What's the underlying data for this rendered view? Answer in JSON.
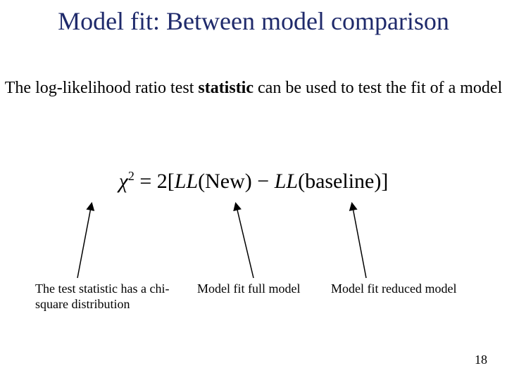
{
  "title": "Model fit: Between model comparison",
  "subtitle_parts": {
    "pre": "The log-likelihood ratio test ",
    "bold": "statistic",
    "post": " can be used to test the fit of a model"
  },
  "formula": {
    "lhs_sym": "χ",
    "lhs_sup": "2",
    "eq": " = ",
    "coef": "2",
    "open": "[",
    "fn1": "LL",
    "arg1": "(New)",
    "minus": " − ",
    "fn2": "LL",
    "arg2": "(baseline)",
    "close": "]"
  },
  "annotations": {
    "left": "The test statistic has a chi-square distribution",
    "mid": "Model fit full model",
    "right": "Model fit reduced model"
  },
  "page_number": "18"
}
